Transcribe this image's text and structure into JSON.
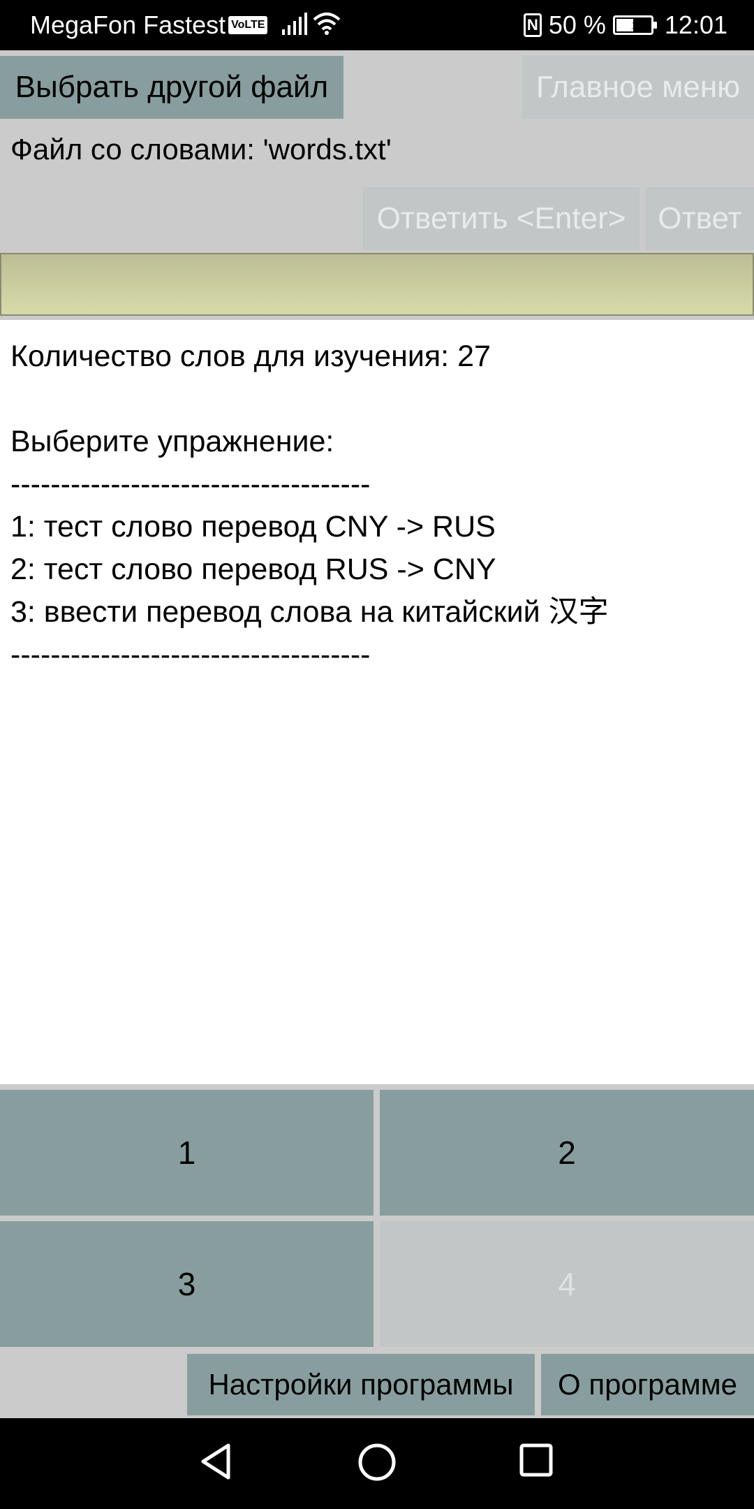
{
  "status_bar": {
    "carrier": "MegaFon Fastest",
    "volte": "VoLTE",
    "nfc": "N",
    "battery": "50 %",
    "time": "12:01"
  },
  "toolbar": {
    "choose_file": "Выбрать другой файл",
    "main_menu": "Главное меню"
  },
  "file_label": "Файл со словами: 'words.txt'",
  "answer_buttons": {
    "answer_enter": "Ответить <Enter>",
    "answer": "Ответ"
  },
  "answer_input": {
    "value": ""
  },
  "content": {
    "lines": [
      "Количество слов для изучения: 27",
      "",
      "Выберите упражнение:",
      "------------------------------------",
      "1: тест слово перевод CNY -> RUS",
      "2: тест слово перевод RUS -> CNY",
      "3: ввести перевод слова на китайский 汉字",
      "------------------------------------"
    ]
  },
  "choice_buttons": {
    "b1": "1",
    "b2": "2",
    "b3": "3",
    "b4": "4"
  },
  "footer": {
    "settings": "Настройки программы",
    "about": "О программе"
  },
  "colors": {
    "active_button": "#889e9e",
    "disabled_button": "#c2c6c6",
    "panel": "#cbcbcb",
    "input": "#d7dbaa"
  }
}
